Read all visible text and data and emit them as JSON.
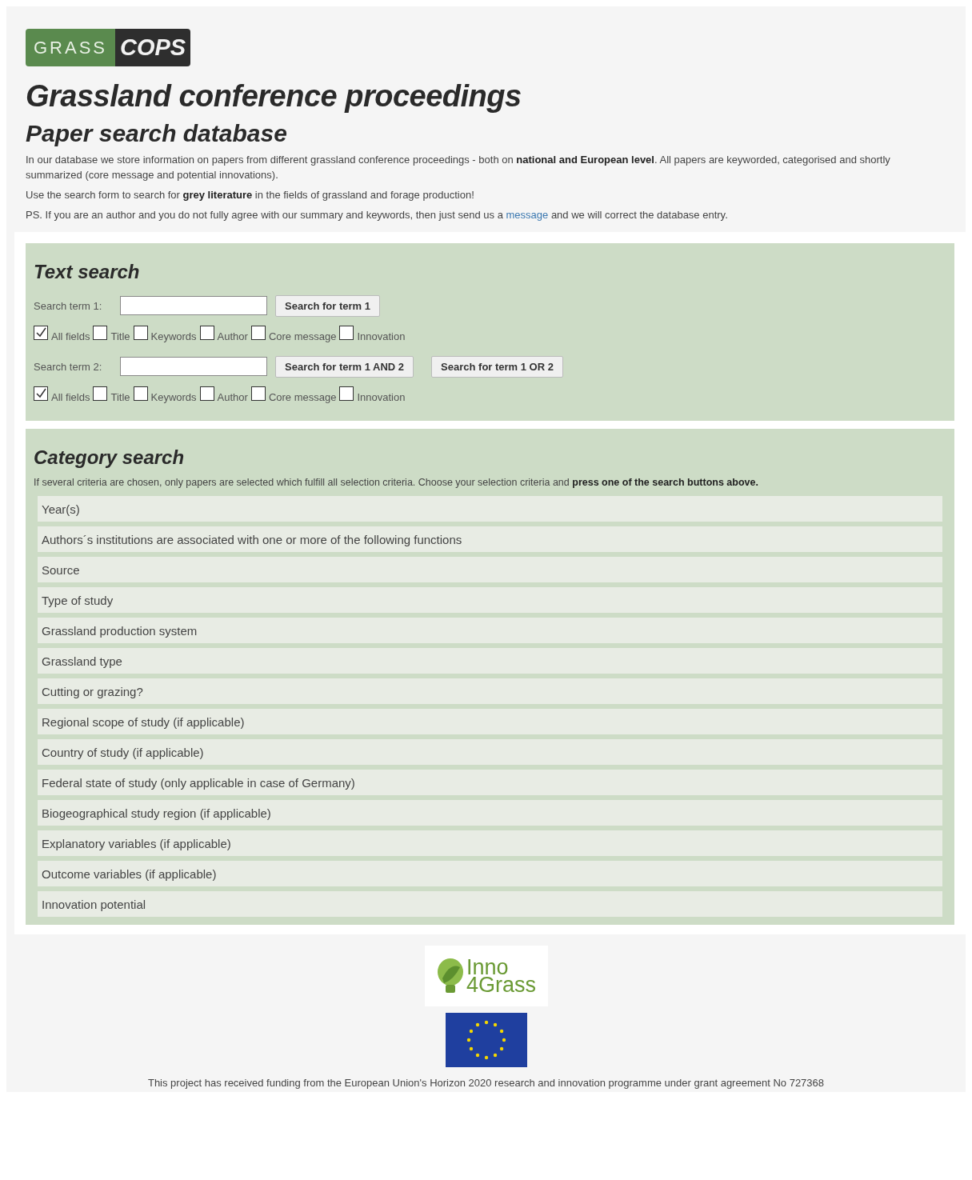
{
  "logo": {
    "part1": "GRASS",
    "part2": "COPS"
  },
  "title": "Grassland conference proceedings",
  "subtitle": "Paper search database",
  "intro": [
    "In our database we store information on papers from different grassland conference proceedings - both on **national and European level**. All papers are keyworded, categorised and shortly summarized (core message and potential innovations).",
    "Use the search form to search for **grey literature** in the fields of grassland and forage production!"
  ],
  "ps": {
    "before": "PS. If you are an author and you do not fully agree with our summary and keywords, then just send us a",
    "link": "message",
    "after": "and we will correct the database entry."
  },
  "text_search": {
    "title": "Text search",
    "terms": [
      {
        "label": "Search term 1:",
        "buttons": [
          "Search for term 1"
        ],
        "fields": [
          {
            "label": "All fields",
            "checked": true
          },
          {
            "label": "Title",
            "checked": false
          },
          {
            "label": "Keywords",
            "checked": false
          },
          {
            "label": "Author",
            "checked": false
          },
          {
            "label": "Core message",
            "checked": false
          },
          {
            "label": "Innovation",
            "checked": false
          }
        ]
      },
      {
        "label": "Search term 2:",
        "buttons": [
          "Search for term 1 AND 2",
          "Search for term 1 OR 2"
        ],
        "fields": [
          {
            "label": "All fields",
            "checked": true
          },
          {
            "label": "Title",
            "checked": false
          },
          {
            "label": "Keywords",
            "checked": false
          },
          {
            "label": "Author",
            "checked": false
          },
          {
            "label": "Core message",
            "checked": false
          },
          {
            "label": "Innovation",
            "checked": false
          }
        ]
      }
    ]
  },
  "category_search": {
    "title": "Category search",
    "note": "If several criteria are chosen, only papers are selected which fulfill all selection criteria. Choose your selection criteria and **press one of the search buttons above.**",
    "items": [
      "Year(s)",
      "Authors´s institutions are associated with one or more of the following functions",
      "Source",
      "Type of study",
      "Grassland production system",
      "Grassland type",
      "Cutting or grazing?",
      "Regional scope of study (if applicable)",
      "Country of study (if applicable)",
      "Federal state of study (only applicable in case of Germany)",
      "Biogeographical study region (if applicable)",
      "Explanatory variables (if applicable)",
      "Outcome variables (if applicable)",
      "Innovation potential"
    ]
  },
  "footer": {
    "partner_logo": {
      "line1": "Inno",
      "line2": "4Grass"
    },
    "funding": "This project has received funding from the European Union's Horizon 2020 research and innovation programme under grant agreement No 727368"
  }
}
